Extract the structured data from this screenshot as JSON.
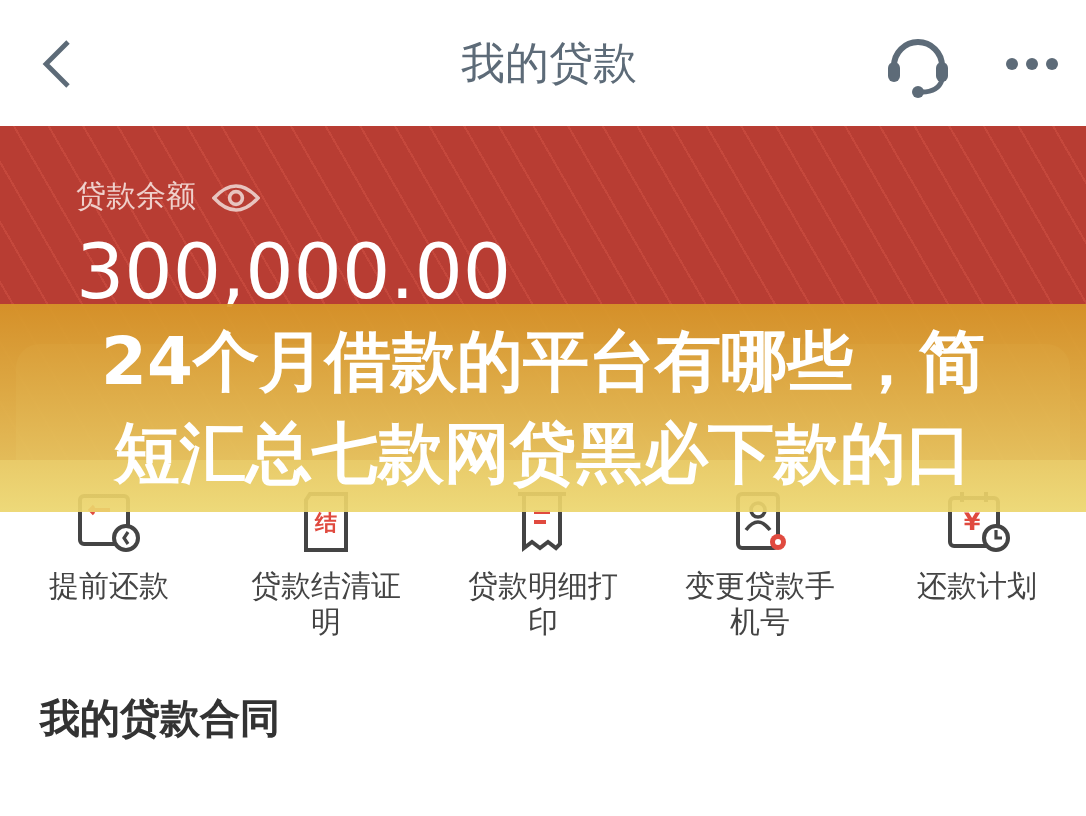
{
  "header": {
    "title": "我的贷款"
  },
  "balance": {
    "label": "贷款余额",
    "amount": "300,000.00"
  },
  "services": [
    {
      "kind": "prepay",
      "label": "提前还款"
    },
    {
      "kind": "settle",
      "label": "贷款结清证明",
      "glyph": "结"
    },
    {
      "kind": "detail",
      "label": "贷款明细打印"
    },
    {
      "kind": "phone",
      "label": "变更贷款手机号"
    },
    {
      "kind": "plan",
      "label": "还款计划",
      "glyph": "¥"
    }
  ],
  "section_title": "我的贷款合同",
  "headline": {
    "lines": [
      "24个月借款的平台有哪些，简",
      "短汇总七款网贷黑必下款的口"
    ]
  }
}
